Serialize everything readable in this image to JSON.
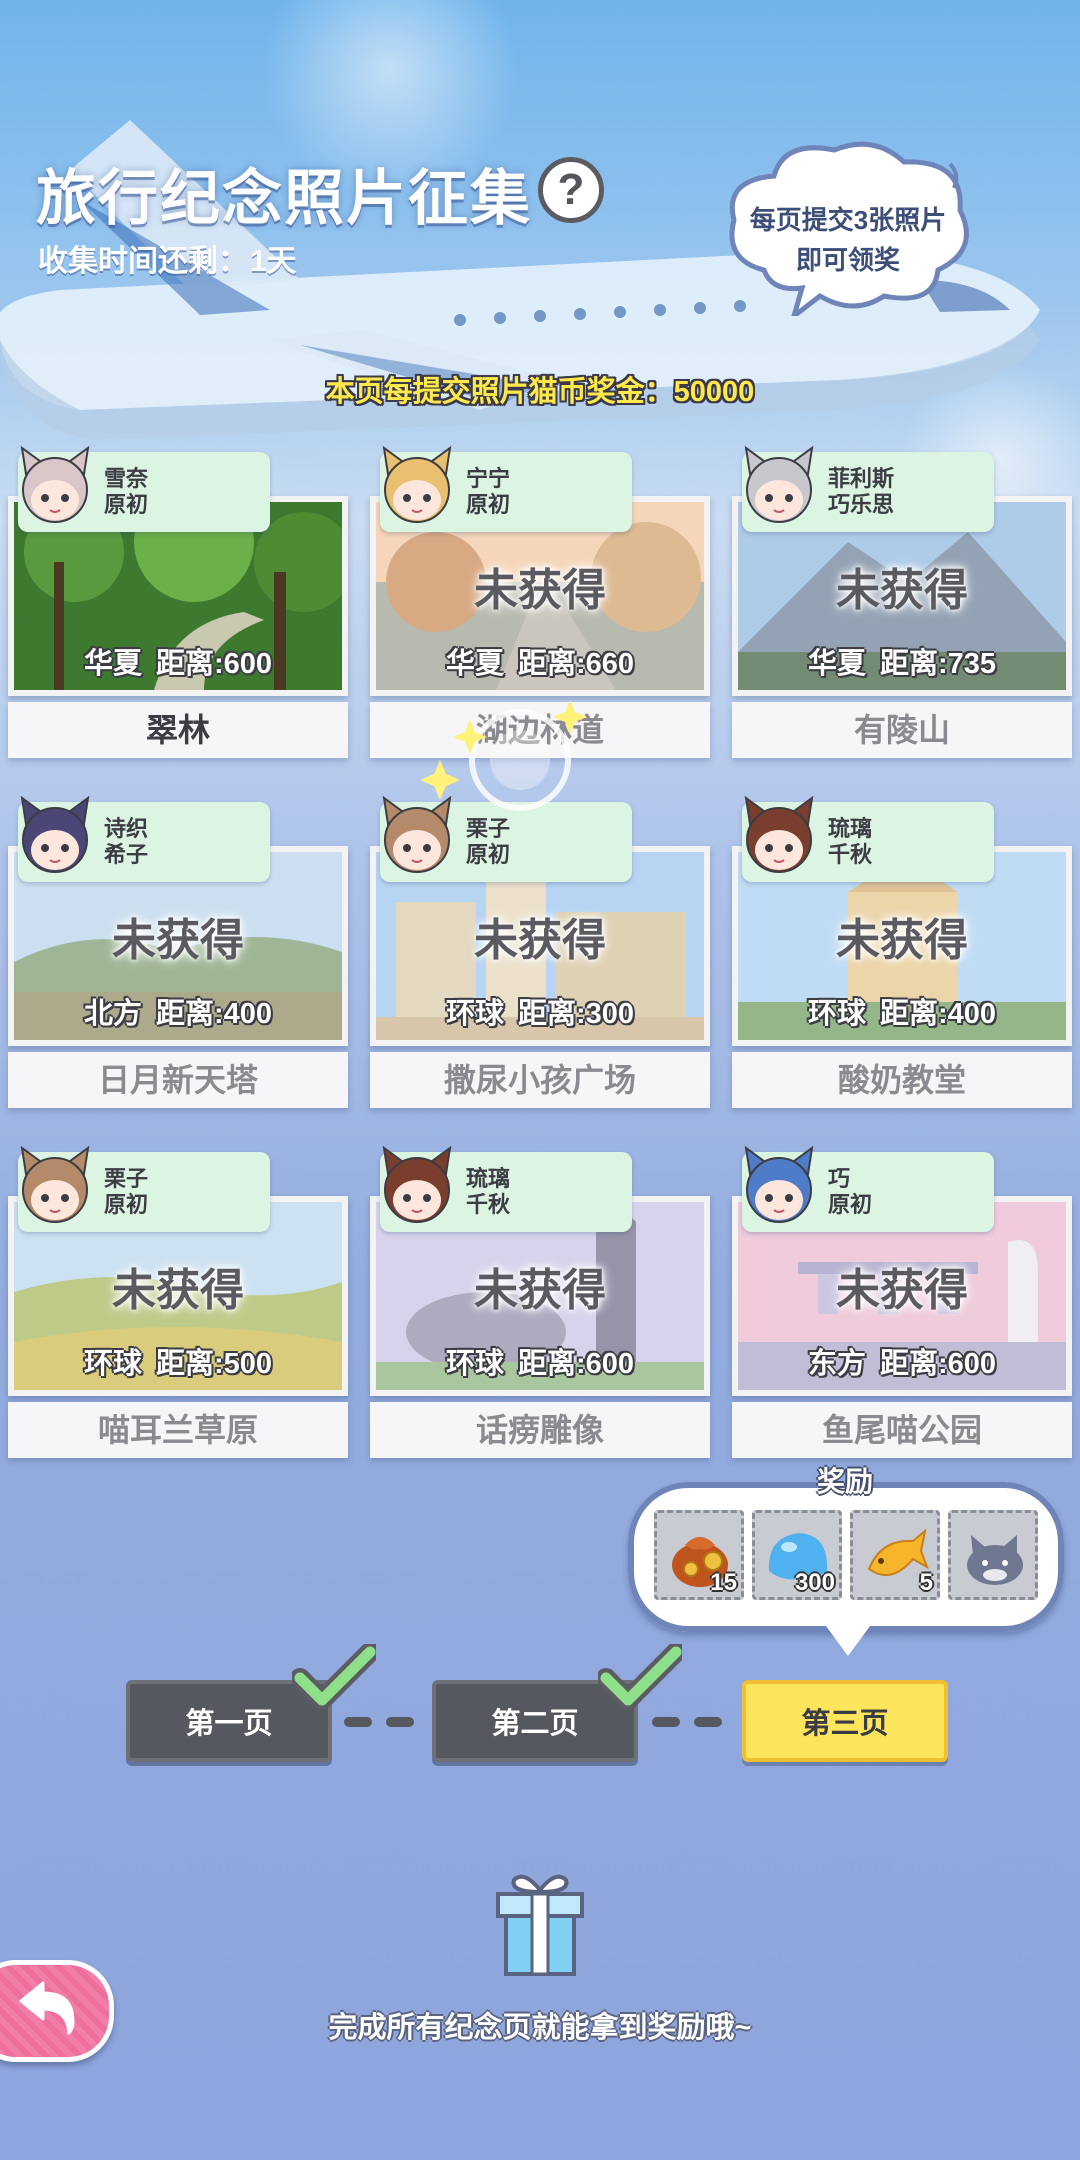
{
  "header": {
    "title": "旅行纪念照片征集",
    "help_icon": "question-mark-icon",
    "time_label": "收集时间还剩：",
    "time_value": "1天",
    "cloud_line1": "每页提交3张照片",
    "cloud_line2": "即可领奖",
    "bonus": "本页每提交照片猫币奖金：50000"
  },
  "not_obtained_label": "未获得",
  "cards": [
    {
      "char1": "雪奈",
      "char2": "原初",
      "region": "华夏",
      "distance": "距离:600",
      "place": "翠林",
      "obtained": true
    },
    {
      "char1": "宁宁",
      "char2": "原初",
      "region": "华夏",
      "distance": "距离:660",
      "place": "湖边林道",
      "obtained": false
    },
    {
      "char1": "菲利斯",
      "char2": "巧乐思",
      "region": "华夏",
      "distance": "距离:735",
      "place": "有陵山",
      "obtained": false
    },
    {
      "char1": "诗织",
      "char2": "希子",
      "region": "北方",
      "distance": "距离:400",
      "place": "日月新天塔",
      "obtained": false
    },
    {
      "char1": "栗子",
      "char2": "原初",
      "region": "环球",
      "distance": "距离:300",
      "place": "撒尿小孩广场",
      "obtained": false
    },
    {
      "char1": "琉璃",
      "char2": "千秋",
      "region": "环球",
      "distance": "距离:400",
      "place": "酸奶教堂",
      "obtained": false
    },
    {
      "char1": "栗子",
      "char2": "原初",
      "region": "环球",
      "distance": "距离:500",
      "place": "喵耳兰草原",
      "obtained": false
    },
    {
      "char1": "琉璃",
      "char2": "千秋",
      "region": "环球",
      "distance": "距离:600",
      "place": "话痨雕像",
      "obtained": false
    },
    {
      "char1": "巧",
      "char2": "原初",
      "region": "东方",
      "distance": "距离:600",
      "place": "鱼尾喵公园",
      "obtained": false
    }
  ],
  "reward": {
    "label": "奖励",
    "items": [
      {
        "icon": "coin-bag-icon",
        "count": "15"
      },
      {
        "icon": "blue-slime-icon",
        "count": "300"
      },
      {
        "icon": "golden-fish-icon",
        "count": "5"
      },
      {
        "icon": "grey-cat-plush-icon",
        "count": ""
      }
    ]
  },
  "pages": [
    {
      "label": "第一页",
      "state": "done"
    },
    {
      "label": "第二页",
      "state": "done"
    },
    {
      "label": "第三页",
      "state": "active"
    }
  ],
  "bottom_text": "完成所有纪念页就能拿到奖励哦~",
  "colors": {
    "tag_bg": "#dcf5e2",
    "active_page": "#fbe55b",
    "done_page": "#55585e",
    "check_green": "#8ee08a",
    "bonus_text": "#ffe94a",
    "back_button": "#ee6f9c"
  }
}
